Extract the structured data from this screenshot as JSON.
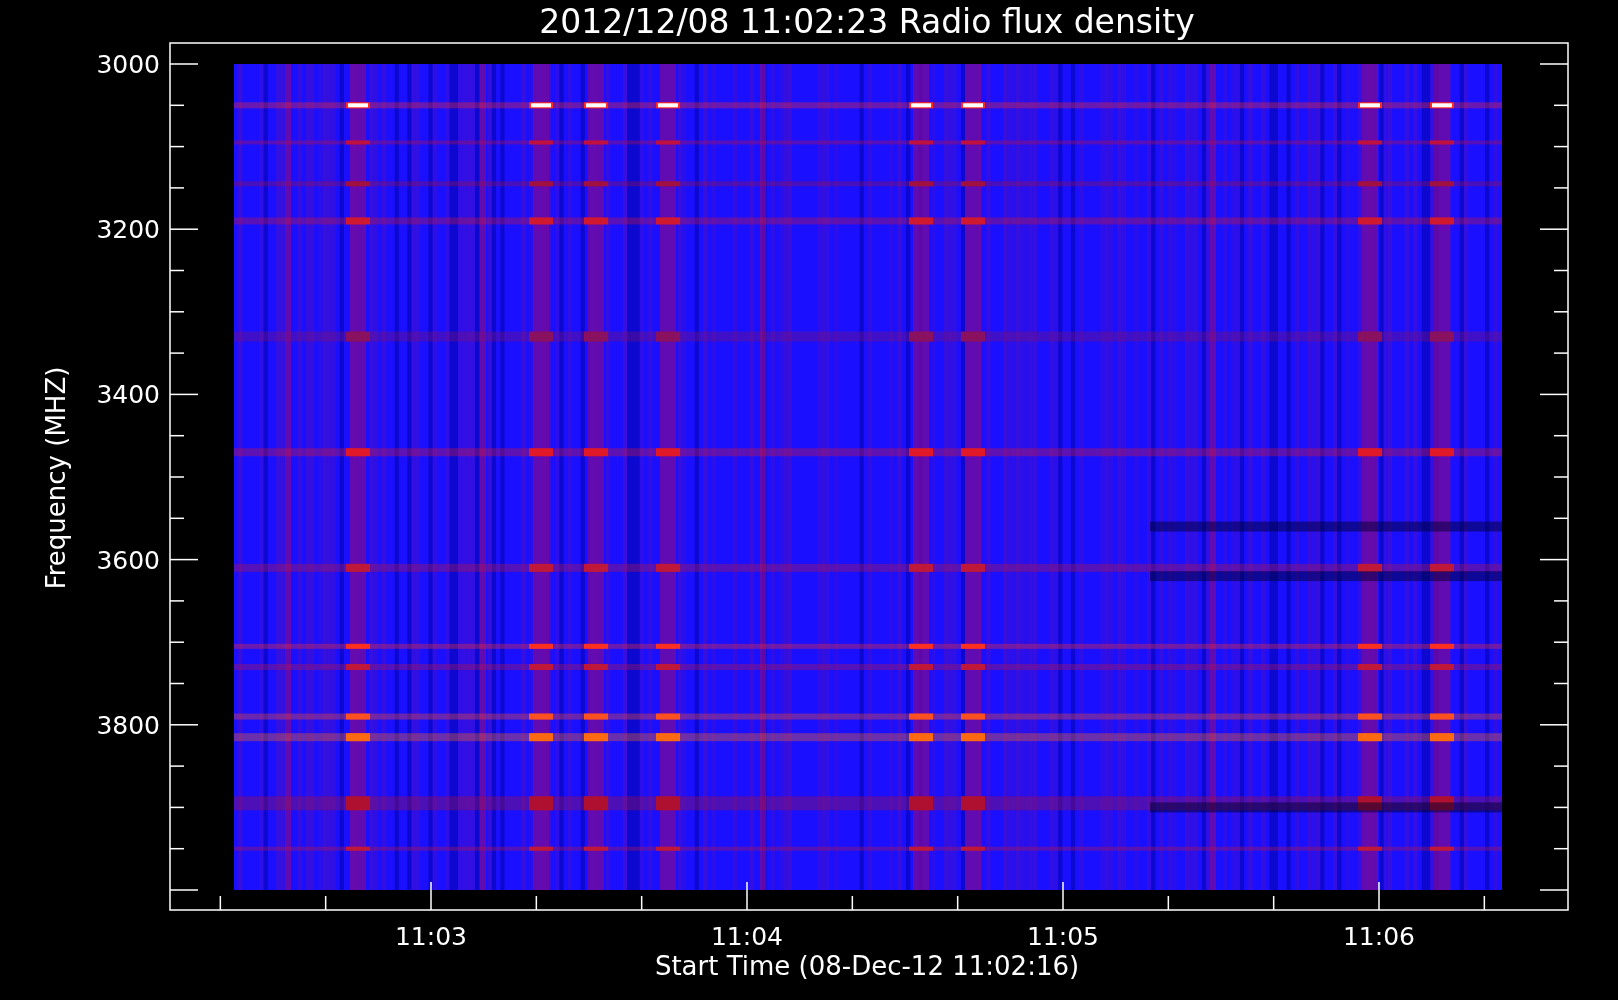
{
  "plot": {
    "title": "2012/12/08 11:02:23 Radio flux density",
    "ylabel": "Frequency (MHZ)",
    "xlabel": "Start Time (08-Dec-12 11:02:16)",
    "y_ticks": [
      "3000",
      "3200",
      "3400",
      "3600",
      "3800"
    ],
    "x_ticks": [
      "11:03",
      "11:04",
      "11:05",
      "11:06"
    ]
  }
}
